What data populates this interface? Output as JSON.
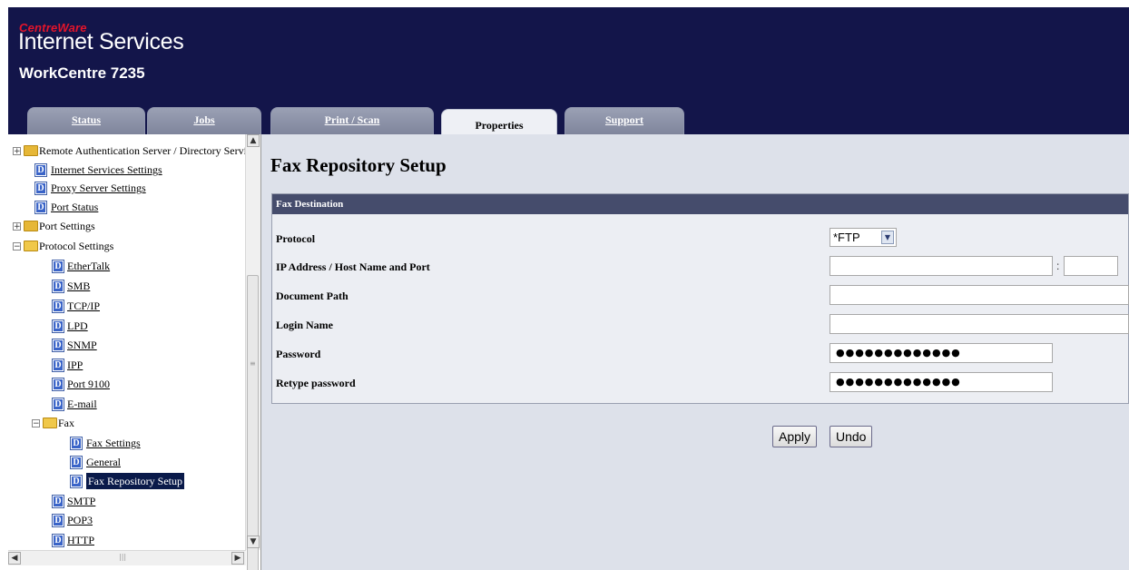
{
  "header": {
    "brand_small": "CentreWare",
    "brand_main": "Internet Services",
    "model": "WorkCentre 7235"
  },
  "tabs": [
    {
      "label": "Status",
      "active": false
    },
    {
      "label": "Jobs",
      "active": false
    },
    {
      "label": "Print / Scan",
      "active": false
    },
    {
      "label": "Properties",
      "active": true
    },
    {
      "label": "Support",
      "active": false
    }
  ],
  "tree": [
    {
      "label": "Remote Authentication Server / Directory Service",
      "type": "folder",
      "expand": "+",
      "link": false
    },
    {
      "label": "Internet Services Settings",
      "type": "doc",
      "link": true
    },
    {
      "label": "Proxy Server Settings",
      "type": "doc",
      "link": true
    },
    {
      "label": "Port Status",
      "type": "doc",
      "link": true
    },
    {
      "label": "Port Settings",
      "type": "folder",
      "expand": "+",
      "link": false
    },
    {
      "label": "Protocol Settings",
      "type": "folder-open",
      "expand": "−",
      "link": false
    },
    {
      "label": "EtherTalk",
      "type": "doc",
      "link": true
    },
    {
      "label": "SMB",
      "type": "doc",
      "link": true
    },
    {
      "label": "TCP/IP",
      "type": "doc",
      "link": true
    },
    {
      "label": "LPD",
      "type": "doc",
      "link": true
    },
    {
      "label": "SNMP",
      "type": "doc",
      "link": true
    },
    {
      "label": "IPP",
      "type": "doc",
      "link": true
    },
    {
      "label": "Port 9100",
      "type": "doc",
      "link": true
    },
    {
      "label": "E-mail",
      "type": "doc",
      "link": true
    },
    {
      "label": "Fax",
      "type": "folder-open",
      "expand": "−",
      "link": false
    },
    {
      "label": "Fax Settings",
      "type": "doc",
      "link": true
    },
    {
      "label": "General",
      "type": "doc",
      "link": true
    },
    {
      "label": "Fax Repository Setup",
      "type": "doc",
      "link": true,
      "selected": true
    },
    {
      "label": "SMTP",
      "type": "doc",
      "link": true
    },
    {
      "label": "POP3",
      "type": "doc",
      "link": true
    },
    {
      "label": "HTTP",
      "type": "doc",
      "link": true
    }
  ],
  "main": {
    "title": "Fax Repository Setup",
    "section_title": "Fax Destination",
    "fields": {
      "protocol": {
        "label": "Protocol",
        "value": "*FTP"
      },
      "ip_address": {
        "label": "IP Address / Host Name and Port",
        "value": "",
        "port_value": "",
        "separator": ":"
      },
      "document_path": {
        "label": "Document Path",
        "value": ""
      },
      "login_name": {
        "label": "Login Name",
        "value": ""
      },
      "password": {
        "label": "Password",
        "masked": "●●●●●●●●●●●●●"
      },
      "retype_password": {
        "label": "Retype password",
        "masked": "●●●●●●●●●●●●●"
      }
    },
    "buttons": {
      "apply": "Apply",
      "undo": "Undo"
    }
  },
  "icons": {
    "folder": "folder-icon",
    "document": "page-icon",
    "expand": "tree-expander-icon"
  },
  "colors": {
    "header_bg": "#13154a",
    "brand_red": "#e3152b",
    "section_header_bg": "#454c6c",
    "content_bg": "#dde1ea",
    "selected_bg": "#0a1a4a"
  }
}
